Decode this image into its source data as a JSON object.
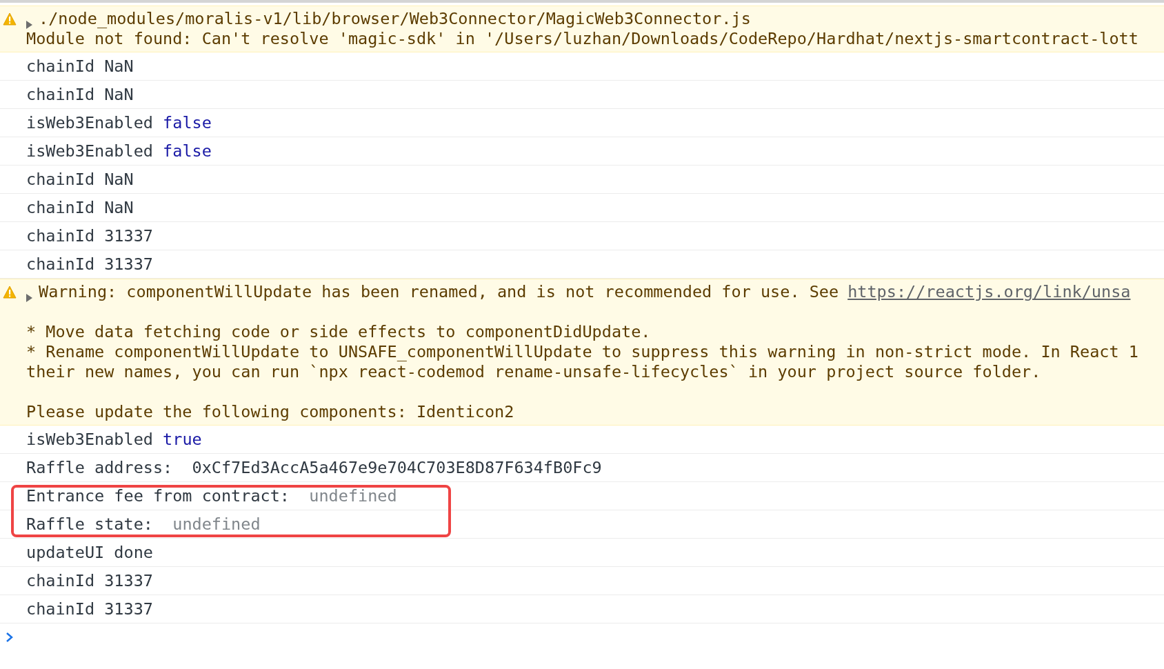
{
  "console": {
    "messages": [
      {
        "kind": "warning",
        "expandable": true,
        "title_parts": [
          {
            "kind": "plain",
            "text": "./node_modules/moralis-v1/lib/browser/Web3Connector/MagicWeb3Connector.js"
          }
        ],
        "paragraphs": [
          [
            "Module not found: Can't resolve 'magic-sdk' in '/Users/luzhan/Downloads/CodeRepo/Hardhat/nextjs-smartcontract-lott"
          ]
        ]
      },
      {
        "kind": "log",
        "highlighted": false,
        "parts": [
          {
            "kind": "plain",
            "text": "chainId NaN"
          }
        ]
      },
      {
        "kind": "log",
        "highlighted": false,
        "parts": [
          {
            "kind": "plain",
            "text": "chainId NaN"
          }
        ]
      },
      {
        "kind": "log",
        "highlighted": false,
        "parts": [
          {
            "kind": "plain",
            "text": "isWeb3Enabled"
          },
          {
            "kind": "boolean",
            "text": "false"
          }
        ]
      },
      {
        "kind": "log",
        "highlighted": false,
        "parts": [
          {
            "kind": "plain",
            "text": "isWeb3Enabled"
          },
          {
            "kind": "boolean",
            "text": "false"
          }
        ]
      },
      {
        "kind": "log",
        "highlighted": false,
        "parts": [
          {
            "kind": "plain",
            "text": "chainId NaN"
          }
        ]
      },
      {
        "kind": "log",
        "highlighted": false,
        "parts": [
          {
            "kind": "plain",
            "text": "chainId NaN"
          }
        ]
      },
      {
        "kind": "log",
        "highlighted": false,
        "parts": [
          {
            "kind": "plain",
            "text": "chainId 31337"
          }
        ]
      },
      {
        "kind": "log",
        "highlighted": false,
        "parts": [
          {
            "kind": "plain",
            "text": "chainId 31337"
          }
        ]
      },
      {
        "kind": "warning",
        "expandable": true,
        "title_parts": [
          {
            "kind": "plain",
            "text": "Warning: componentWillUpdate has been renamed, and is not recommended for use. See"
          },
          {
            "kind": "link",
            "text": "https://reactjs.org/link/unsa"
          }
        ],
        "paragraphs": [
          [
            "* Move data fetching code or side effects to componentDidUpdate.",
            "* Rename componentWillUpdate to UNSAFE_componentWillUpdate to suppress this warning in non-strict mode. In React 1",
            "their new names, you can run `npx react-codemod rename-unsafe-lifecycles` in your project source folder."
          ],
          [
            "Please update the following components: Identicon2"
          ]
        ]
      },
      {
        "kind": "log",
        "highlighted": false,
        "parts": [
          {
            "kind": "plain",
            "text": "isWeb3Enabled"
          },
          {
            "kind": "boolean",
            "text": "true"
          }
        ]
      },
      {
        "kind": "log",
        "highlighted": false,
        "parts": [
          {
            "kind": "plain",
            "text": "Raffle address: "
          },
          {
            "kind": "plain",
            "text": "0xCf7Ed3AccA5a467e9e704C703E8D87F634fB0Fc9"
          }
        ]
      },
      {
        "kind": "log",
        "highlighted": true,
        "parts": [
          {
            "kind": "plain",
            "text": "Entrance fee from contract: "
          },
          {
            "kind": "undefined",
            "text": "undefined"
          }
        ]
      },
      {
        "kind": "log",
        "highlighted": true,
        "parts": [
          {
            "kind": "plain",
            "text": "Raffle state: "
          },
          {
            "kind": "undefined",
            "text": "undefined"
          }
        ]
      },
      {
        "kind": "log",
        "highlighted": false,
        "parts": [
          {
            "kind": "plain",
            "text": "updateUI done"
          }
        ]
      },
      {
        "kind": "log",
        "highlighted": false,
        "parts": [
          {
            "kind": "plain",
            "text": "chainId 31337"
          }
        ]
      },
      {
        "kind": "log",
        "highlighted": false,
        "parts": [
          {
            "kind": "plain",
            "text": "chainId 31337"
          }
        ]
      }
    ]
  }
}
